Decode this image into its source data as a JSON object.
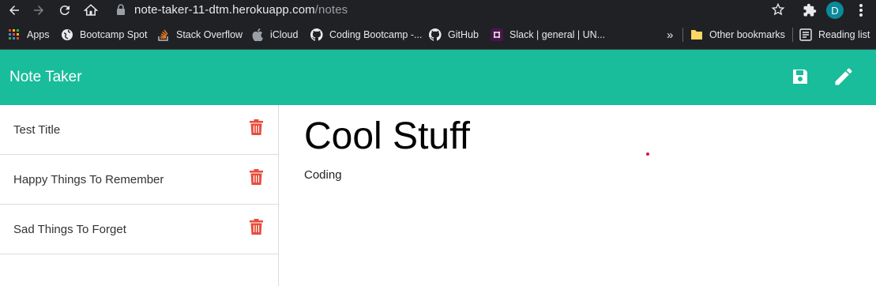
{
  "browser": {
    "url_host": "note-taker-11-dtm.herokuapp.com",
    "url_path": "/notes",
    "profile_initial": "D",
    "bookmarks": [
      {
        "label": "Apps",
        "icon": "apps-grid-icon"
      },
      {
        "label": "Bootcamp Spot",
        "icon": "globe-icon"
      },
      {
        "label": "Stack Overflow",
        "icon": "stack-overflow-icon"
      },
      {
        "label": "iCloud",
        "icon": "apple-icon"
      },
      {
        "label": "Coding Bootcamp -...",
        "icon": "github-icon"
      },
      {
        "label": "GitHub",
        "icon": "github-icon"
      },
      {
        "label": "Slack | general | UN...",
        "icon": "slack-icon"
      }
    ],
    "overflow_label": "»",
    "other_bookmarks_label": "Other bookmarks",
    "reading_list_label": "Reading list"
  },
  "app": {
    "title": "Note Taker",
    "accent_color": "#19bc9b",
    "notes": [
      {
        "title": "Test Title"
      },
      {
        "title": "Happy Things To Remember"
      },
      {
        "title": "Sad Things To Forget"
      }
    ],
    "active_note": {
      "title": "Cool Stuff",
      "text": "Coding"
    },
    "delete_color": "#e74c3c"
  }
}
